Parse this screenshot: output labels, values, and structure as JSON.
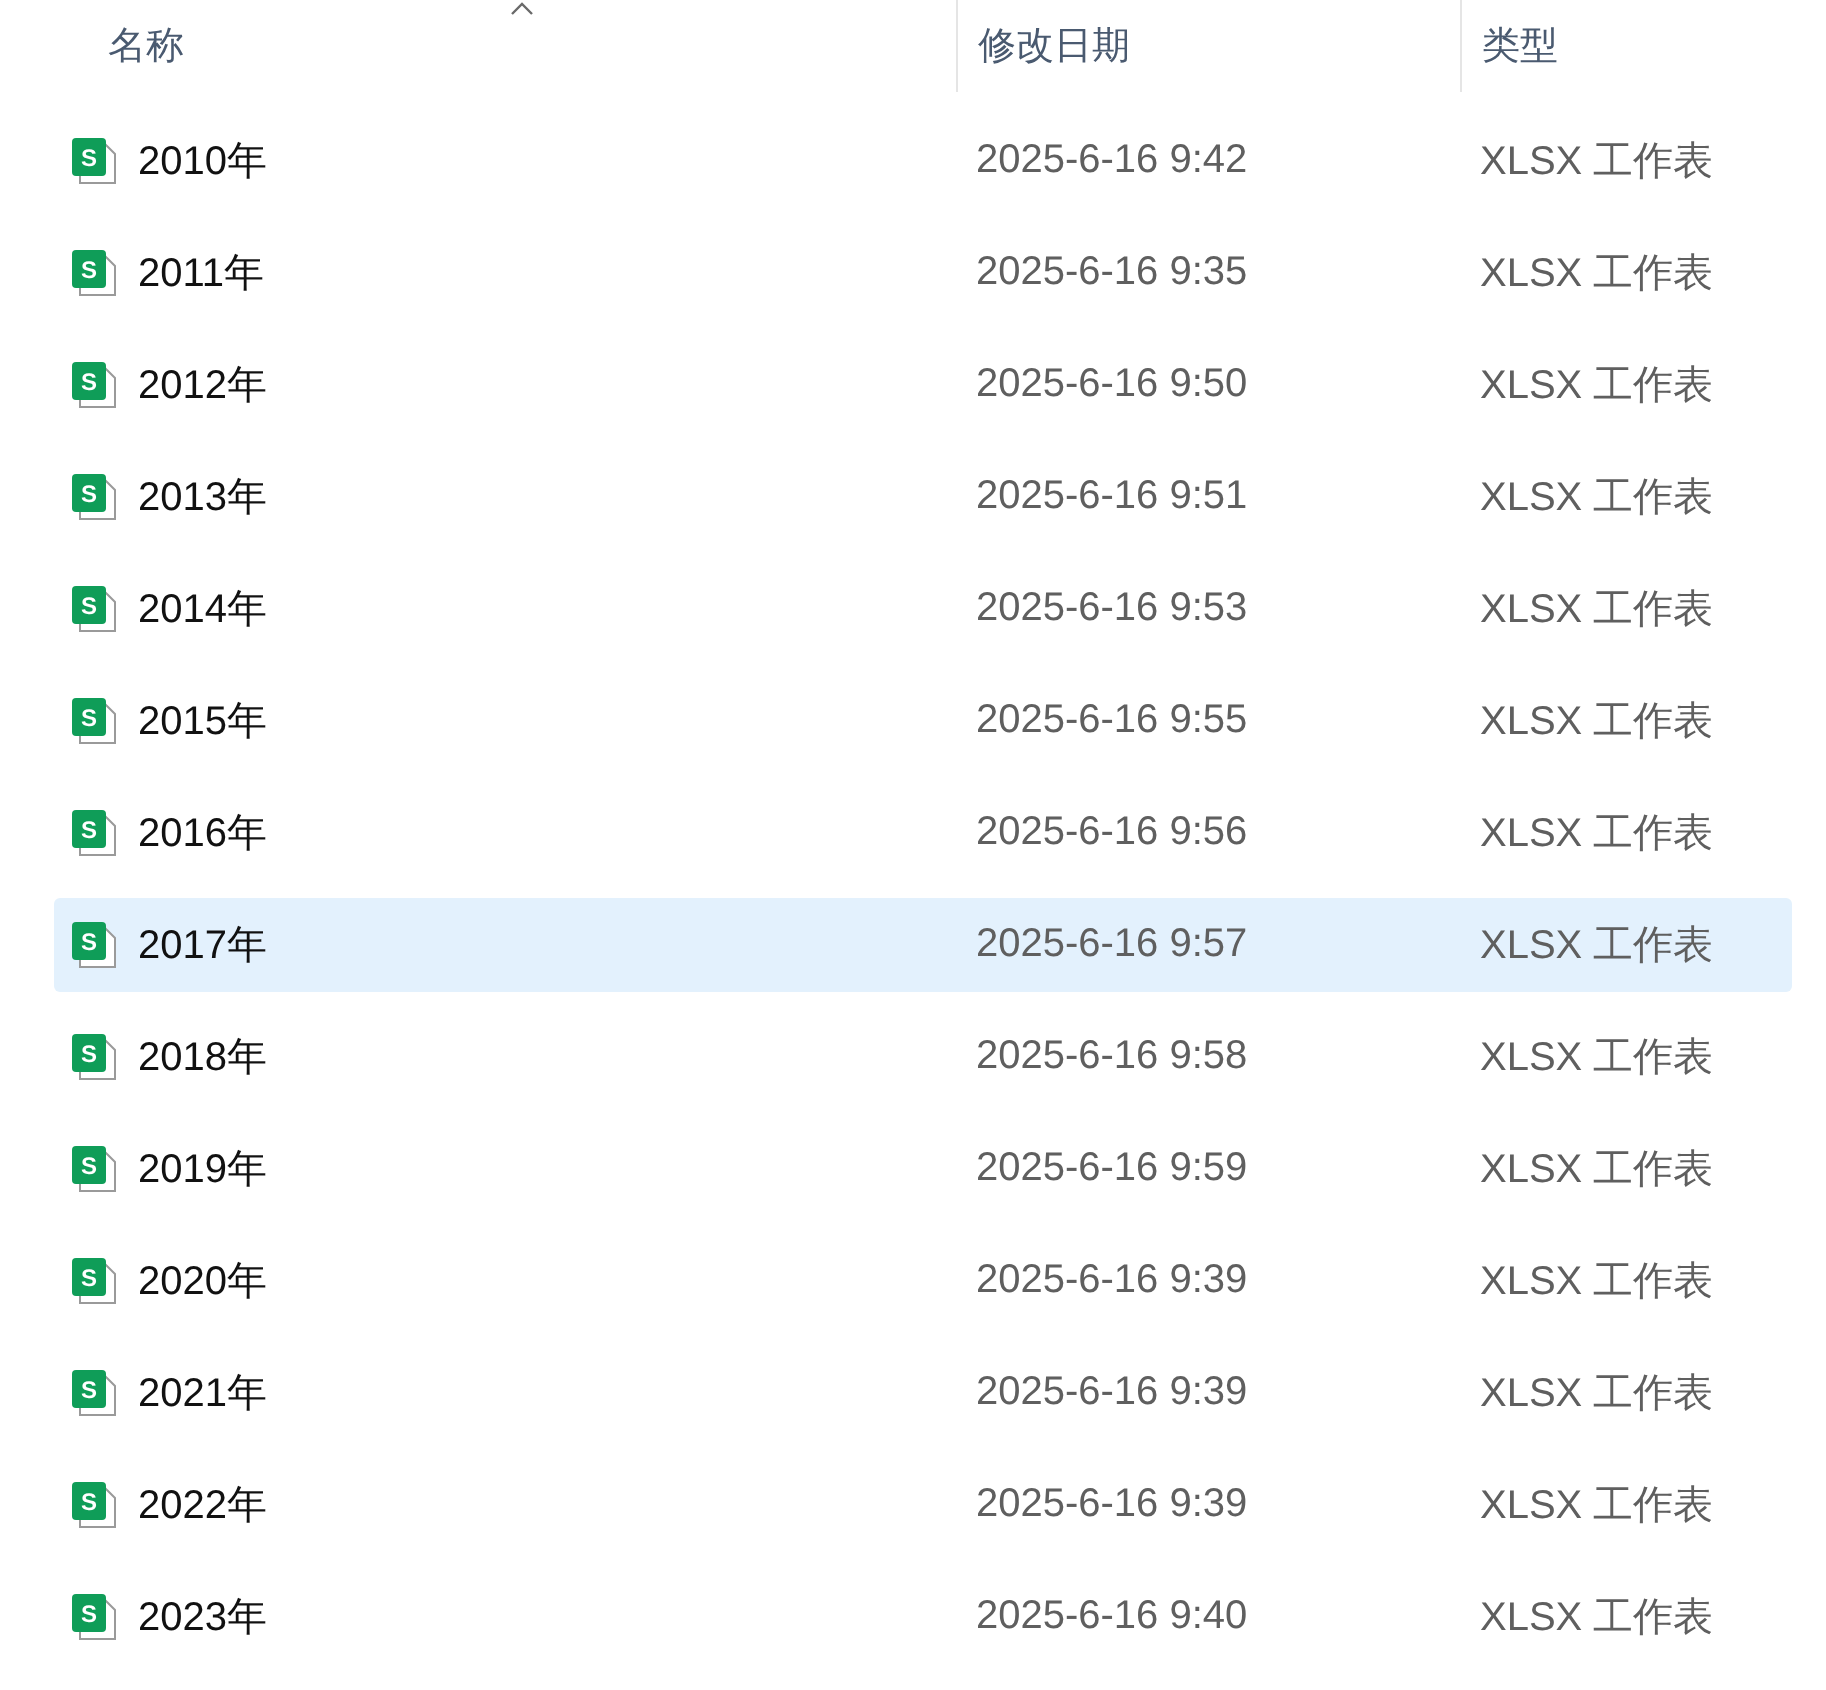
{
  "columns": [
    {
      "label": "名称",
      "sorted": true
    },
    {
      "label": "修改日期",
      "sorted": false
    },
    {
      "label": "类型",
      "sorted": false
    }
  ],
  "rows": [
    {
      "icon_label": "S",
      "name": "2010年",
      "modified": "2025-6-16 9:42",
      "type": "XLSX 工作表",
      "selected": false
    },
    {
      "icon_label": "S",
      "name": "2011年",
      "modified": "2025-6-16 9:35",
      "type": "XLSX 工作表",
      "selected": false
    },
    {
      "icon_label": "S",
      "name": "2012年",
      "modified": "2025-6-16 9:50",
      "type": "XLSX 工作表",
      "selected": false
    },
    {
      "icon_label": "S",
      "name": "2013年",
      "modified": "2025-6-16 9:51",
      "type": "XLSX 工作表",
      "selected": false
    },
    {
      "icon_label": "S",
      "name": "2014年",
      "modified": "2025-6-16 9:53",
      "type": "XLSX 工作表",
      "selected": false
    },
    {
      "icon_label": "S",
      "name": "2015年",
      "modified": "2025-6-16 9:55",
      "type": "XLSX 工作表",
      "selected": false
    },
    {
      "icon_label": "S",
      "name": "2016年",
      "modified": "2025-6-16 9:56",
      "type": "XLSX 工作表",
      "selected": false
    },
    {
      "icon_label": "S",
      "name": "2017年",
      "modified": "2025-6-16 9:57",
      "type": "XLSX 工作表",
      "selected": true
    },
    {
      "icon_label": "S",
      "name": "2018年",
      "modified": "2025-6-16 9:58",
      "type": "XLSX 工作表",
      "selected": false
    },
    {
      "icon_label": "S",
      "name": "2019年",
      "modified": "2025-6-16 9:59",
      "type": "XLSX 工作表",
      "selected": false
    },
    {
      "icon_label": "S",
      "name": "2020年",
      "modified": "2025-6-16 9:39",
      "type": "XLSX 工作表",
      "selected": false
    },
    {
      "icon_label": "S",
      "name": "2021年",
      "modified": "2025-6-16 9:39",
      "type": "XLSX 工作表",
      "selected": false
    },
    {
      "icon_label": "S",
      "name": "2022年",
      "modified": "2025-6-16 9:39",
      "type": "XLSX 工作表",
      "selected": false
    },
    {
      "icon_label": "S",
      "name": "2023年",
      "modified": "2025-6-16 9:40",
      "type": "XLSX 工作表",
      "selected": false
    }
  ]
}
